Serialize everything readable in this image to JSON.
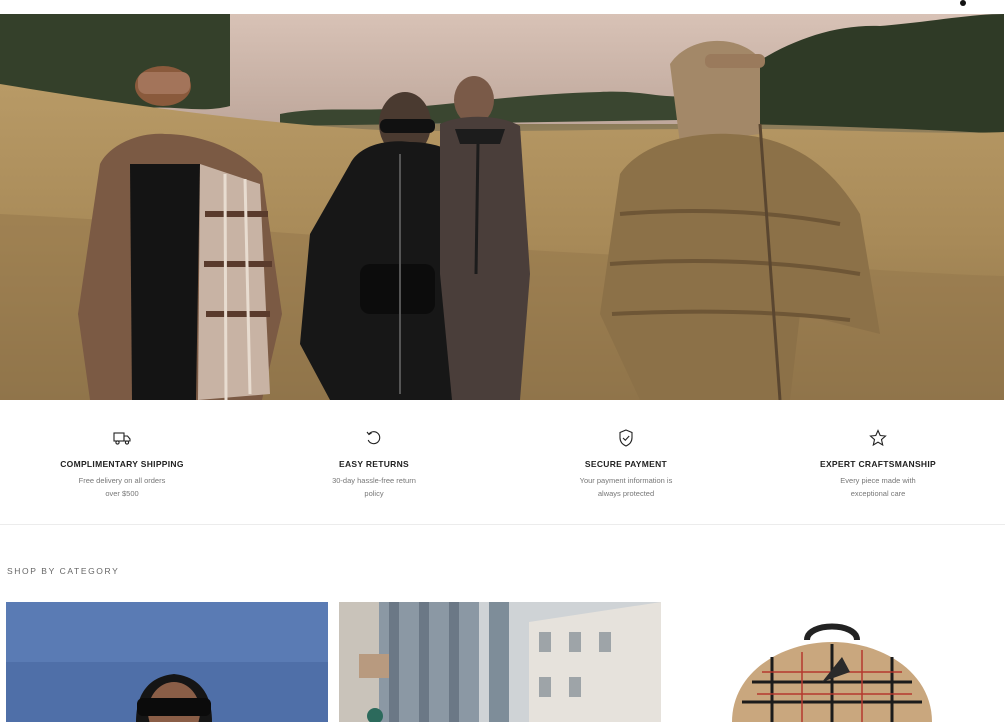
{
  "hero": {
    "image": "campaign-photo-four-people-walking-in-wheat-field"
  },
  "features": [
    {
      "icon": "truck-icon",
      "title": "COMPLIMENTARY SHIPPING",
      "desc": "Free delivery on all orders over $500"
    },
    {
      "icon": "return-icon",
      "title": "EASY RETURNS",
      "desc": "30-day hassle-free return policy"
    },
    {
      "icon": "shield-check-icon",
      "title": "SECURE PAYMENT",
      "desc": "Your payment information is always protected"
    },
    {
      "icon": "star-icon",
      "title": "EXPERT CRAFTSMANSHIP",
      "desc": "Every piece made with exceptional care"
    }
  ],
  "shop": {
    "title": "SHOP BY CATEGORY",
    "categories": [
      {
        "image": "woman-sunglasses-blue-sky"
      },
      {
        "image": "city-street-buildings"
      },
      {
        "image": "check-pattern-backpack"
      }
    ]
  }
}
